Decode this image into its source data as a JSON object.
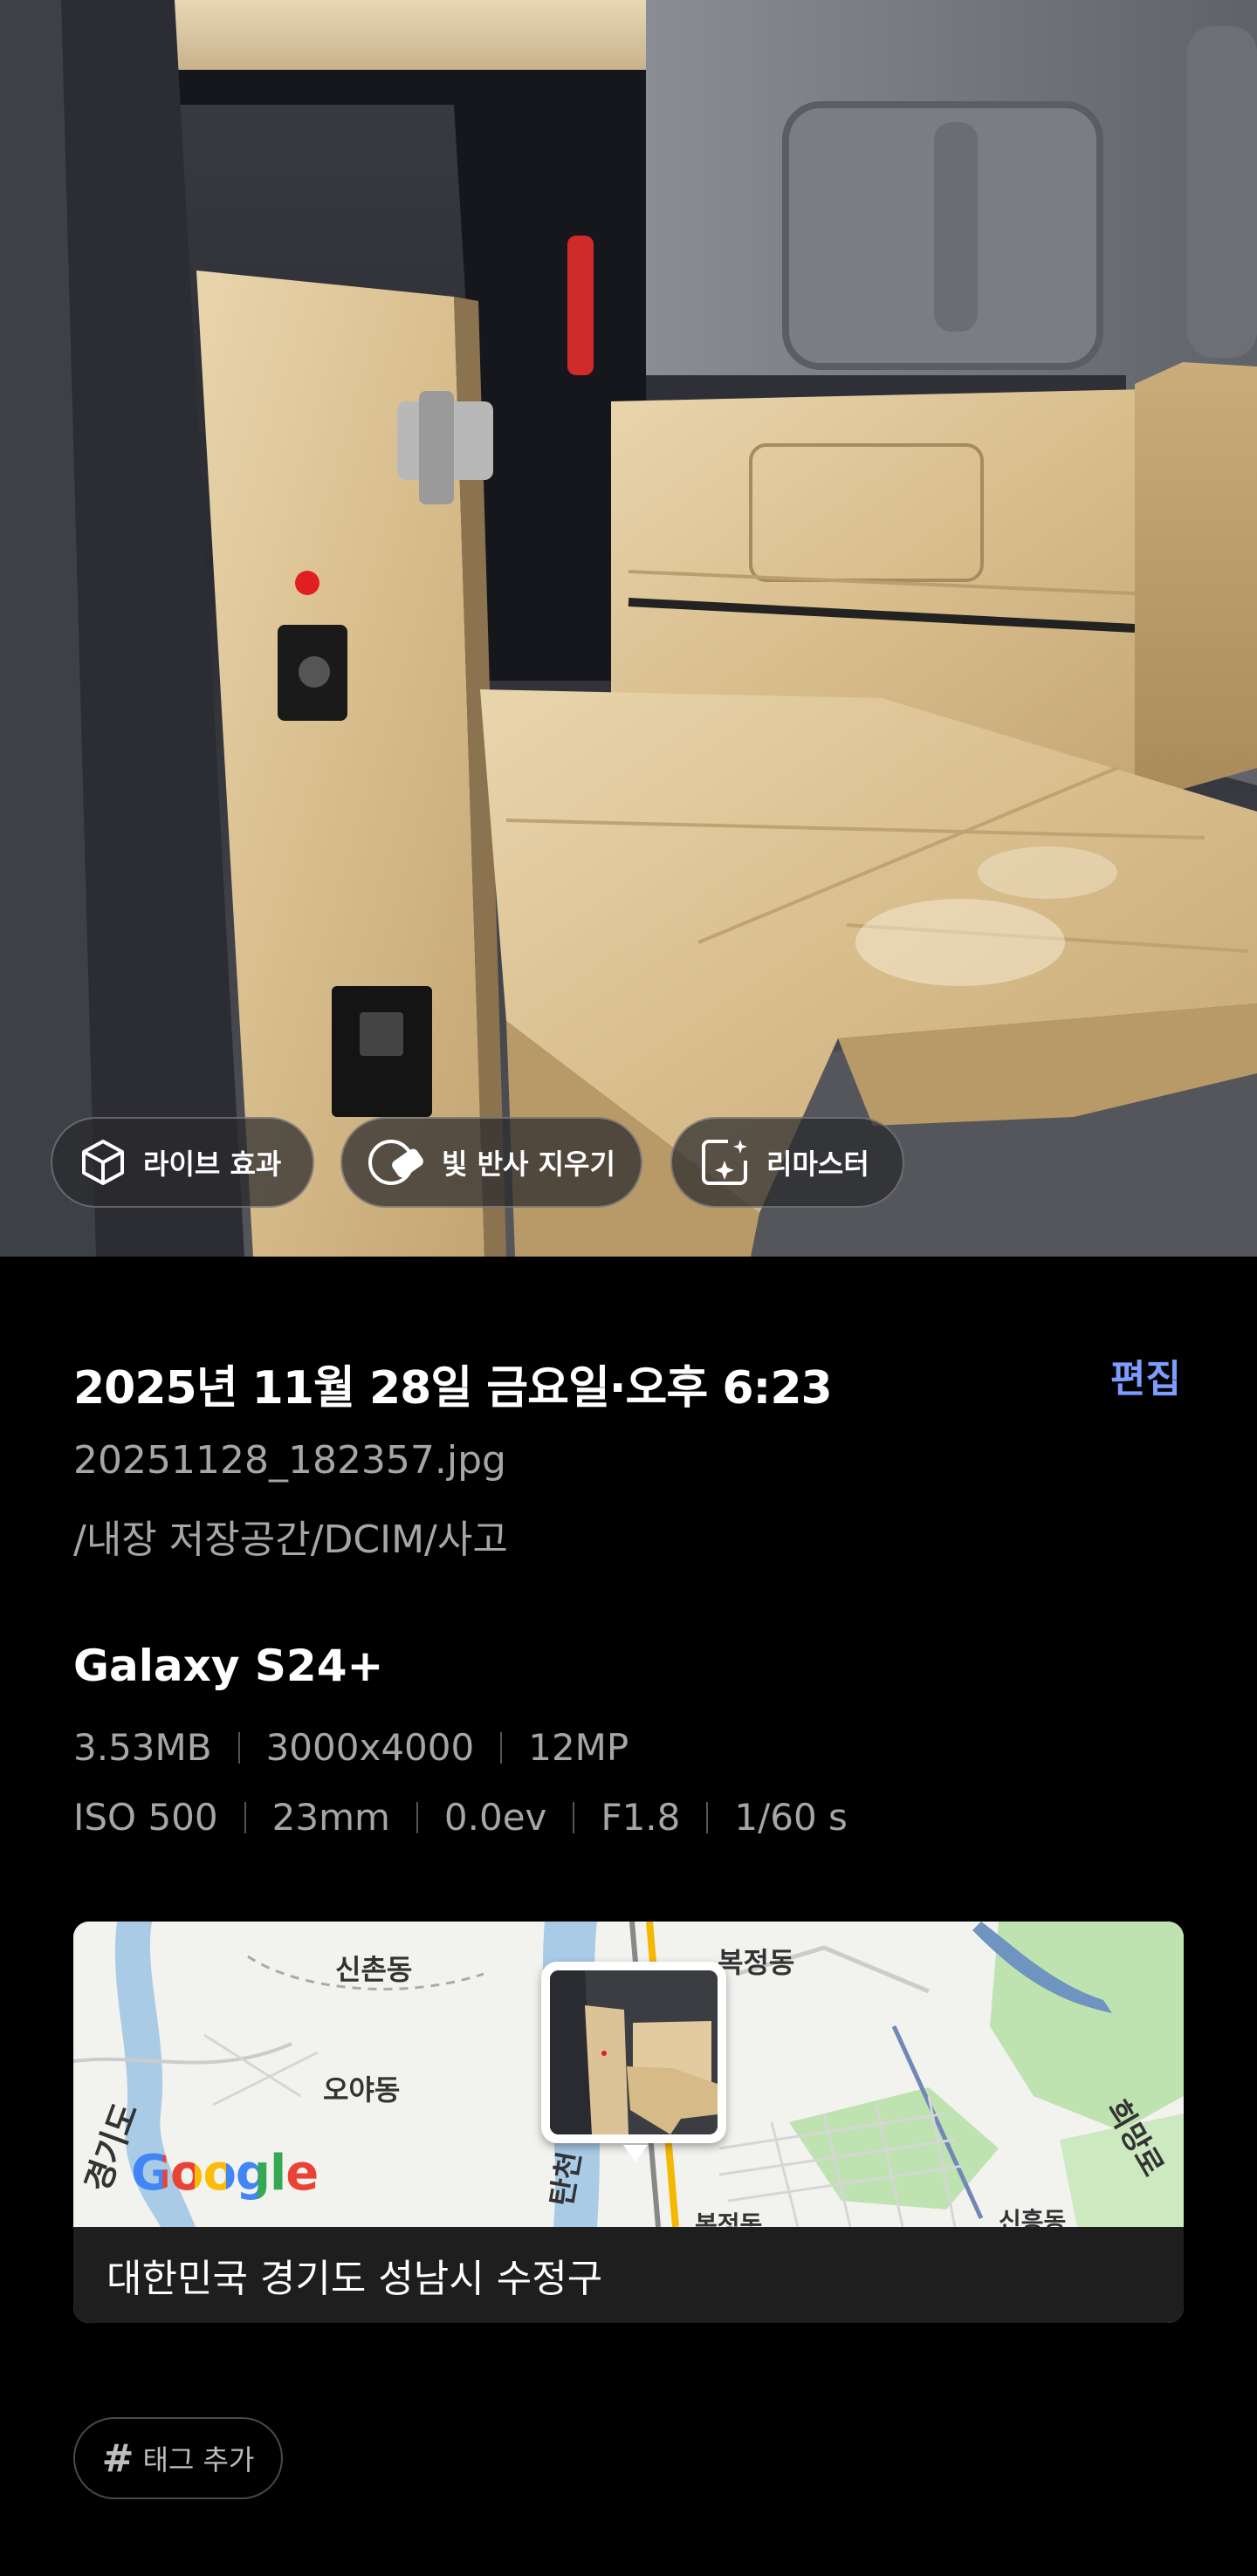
{
  "photo_actions": {
    "live_effect": "라이브 효과",
    "remove_reflection": "빛 반사 지우기",
    "remaster": "리마스터"
  },
  "details": {
    "datetime": "2025년 11월 28일 금요일·오후 6:23",
    "edit_label": "편집",
    "filename": "20251128_182357.jpg",
    "path": "/내장 저장공간/DCIM/사고"
  },
  "camera": {
    "device": "Galaxy S24+",
    "file_specs": [
      "3.53MB",
      "3000x4000",
      "12MP"
    ],
    "exposure_specs": [
      "ISO 500",
      "23mm",
      "0.0ev",
      "F1.8",
      "1/60 s"
    ]
  },
  "location": {
    "map_labels": {
      "sinchon": "신촌동",
      "oya": "오야동",
      "bokjeong": "복정동",
      "gyeonggi_road": "경기도",
      "tancheon": "탄천",
      "huimang_road": "희망로",
      "bottom_left": "복정동",
      "bottom_right": "신흥동"
    },
    "map_provider": "Google",
    "address": "대한민국 경기도 성남시 수정구"
  },
  "tags": {
    "add_label": "태그 추가"
  },
  "colors": {
    "accent": "#7c9cff",
    "background": "#000000",
    "secondary_text": "#a6a6a6"
  }
}
